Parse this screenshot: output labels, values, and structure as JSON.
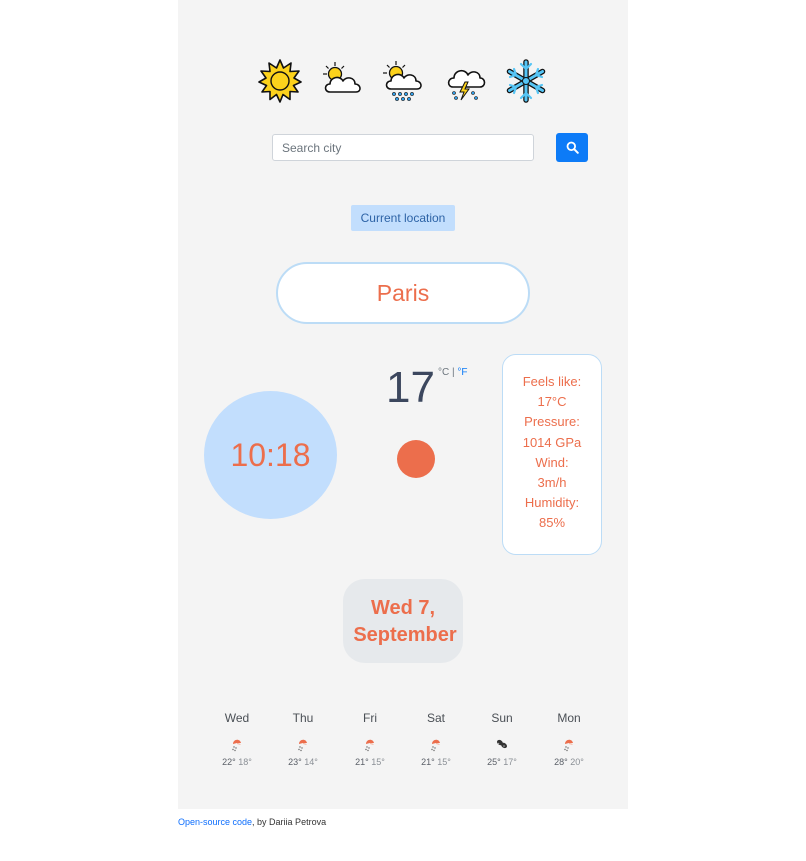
{
  "header_icons": [
    {
      "name": "sun-icon"
    },
    {
      "name": "partly-cloudy-icon"
    },
    {
      "name": "sun-rain-icon"
    },
    {
      "name": "thunderstorm-icon"
    },
    {
      "name": "snowflake-icon"
    }
  ],
  "search": {
    "placeholder": "Search city",
    "value": ""
  },
  "current_location_label": "Current location",
  "city": "Paris",
  "time": "10:18",
  "temperature": "17",
  "units": {
    "celsius": "°C",
    "separator": "|",
    "fahrenheit": "°F"
  },
  "details": {
    "feels_like_label": "Feels like:",
    "feels_like_value": "17°C",
    "pressure_label": "Pressure:",
    "pressure_value": "1014 GPa",
    "wind_label": "Wind:",
    "wind_value": "3m/h",
    "humidity_label": "Humidity:",
    "humidity_value": "85%"
  },
  "date": {
    "line1": "Wed 7,",
    "line2": "September"
  },
  "forecast": [
    {
      "day": "Wed",
      "high": "22°",
      "low": "18°",
      "icon": "light-rain-icon"
    },
    {
      "day": "Thu",
      "high": "23°",
      "low": "14°",
      "icon": "light-rain-icon"
    },
    {
      "day": "Fri",
      "high": "21°",
      "low": "15°",
      "icon": "light-rain-icon"
    },
    {
      "day": "Sat",
      "high": "21°",
      "low": "15°",
      "icon": "light-rain-icon"
    },
    {
      "day": "Sun",
      "high": "25°",
      "low": "17°",
      "icon": "broken-clouds-icon"
    },
    {
      "day": "Mon",
      "high": "28°",
      "low": "20°",
      "icon": "light-rain-icon"
    }
  ],
  "footer": {
    "link_text": "Open-source code",
    "suffix": ", by Dariia Petrova"
  },
  "colors": {
    "accent": "#ec6e4c",
    "primary": "#0d7bf7",
    "light_blue": "#c2defd",
    "panel": "#f4f4f4"
  }
}
